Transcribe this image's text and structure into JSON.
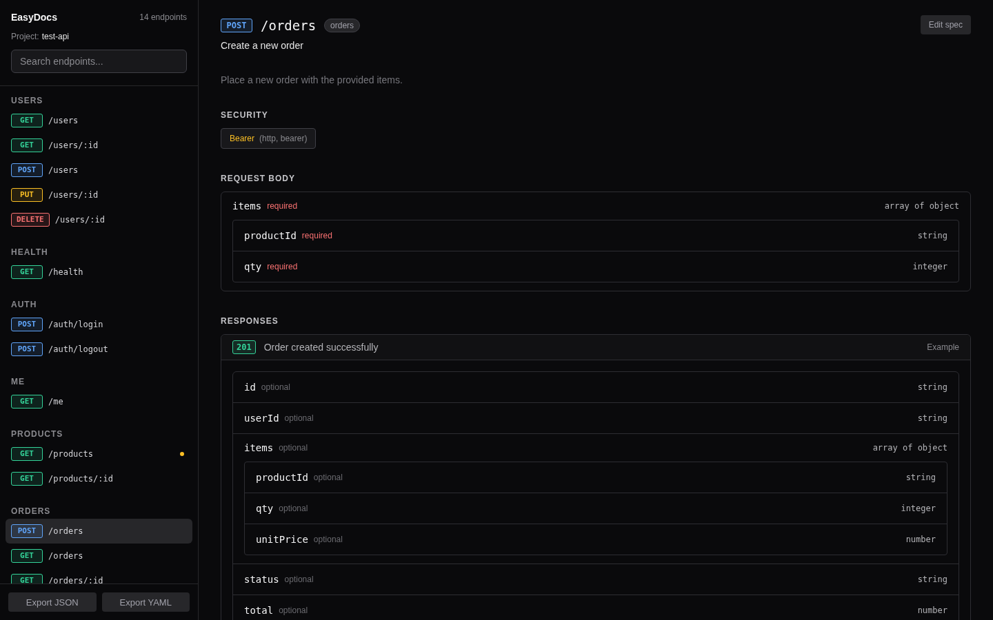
{
  "sidebar": {
    "title": "EasyDocs",
    "count": "14 endpoints",
    "project_label": "Project:",
    "project": "test-api",
    "search": {
      "placeholder": "Search endpoints..."
    },
    "groups": [
      {
        "label": "USERS",
        "items": [
          {
            "method": "GET",
            "color": "#34d399",
            "path": "/users",
            "selected": false,
            "modified": false
          },
          {
            "method": "GET",
            "color": "#34d399",
            "path": "/users/:id",
            "selected": false,
            "modified": false
          },
          {
            "method": "POST",
            "color": "#60a5fa",
            "path": "/users",
            "selected": false,
            "modified": false
          },
          {
            "method": "PUT",
            "color": "#fbbf24",
            "path": "/users/:id",
            "selected": false,
            "modified": false
          },
          {
            "method": "DELETE",
            "color": "#f87171",
            "path": "/users/:id",
            "selected": false,
            "modified": false
          }
        ]
      },
      {
        "label": "HEALTH",
        "items": [
          {
            "method": "GET",
            "color": "#34d399",
            "path": "/health",
            "selected": false,
            "modified": false
          }
        ]
      },
      {
        "label": "AUTH",
        "items": [
          {
            "method": "POST",
            "color": "#60a5fa",
            "path": "/auth/login",
            "selected": false,
            "modified": false
          },
          {
            "method": "POST",
            "color": "#60a5fa",
            "path": "/auth/logout",
            "selected": false,
            "modified": false
          }
        ]
      },
      {
        "label": "ME",
        "items": [
          {
            "method": "GET",
            "color": "#34d399",
            "path": "/me",
            "selected": false,
            "modified": false
          }
        ]
      },
      {
        "label": "PRODUCTS",
        "items": [
          {
            "method": "GET",
            "color": "#34d399",
            "path": "/products",
            "selected": false,
            "modified": true
          },
          {
            "method": "GET",
            "color": "#34d399",
            "path": "/products/:id",
            "selected": false,
            "modified": false
          }
        ]
      },
      {
        "label": "ORDERS",
        "items": [
          {
            "method": "POST",
            "color": "#60a5fa",
            "path": "/orders",
            "selected": true,
            "modified": false
          },
          {
            "method": "GET",
            "color": "#34d399",
            "path": "/orders",
            "selected": false,
            "modified": false
          },
          {
            "method": "GET",
            "color": "#34d399",
            "path": "/orders/:id",
            "selected": false,
            "modified": false
          }
        ]
      }
    ],
    "buttons": [
      "Export JSON",
      "Export YAML"
    ]
  },
  "endpoint": {
    "method": "POST",
    "color": "#60a5fa",
    "path": "/orders",
    "tag": "orders",
    "summary": "Create a new order",
    "description": "Place a new order with the provided items.",
    "edit_button": "Edit spec"
  },
  "security": {
    "heading": "SECURITY",
    "scheme": "Bearer",
    "detail": "(http, bearer)"
  },
  "request_body": {
    "heading": "REQUEST BODY",
    "fields": [
      {
        "name": "items",
        "flag": "required",
        "required": true,
        "type": "array of object",
        "children": [
          {
            "name": "productId",
            "flag": "required",
            "required": true,
            "type": "string"
          },
          {
            "name": "qty",
            "flag": "required",
            "required": true,
            "type": "integer"
          }
        ]
      }
    ]
  },
  "responses": {
    "heading": "RESPONSES",
    "items": [
      {
        "code": "201",
        "color": "#34d399",
        "description": "Order created successfully",
        "example": "Example",
        "fields": [
          {
            "name": "id",
            "flag": "optional",
            "required": false,
            "type": "string"
          },
          {
            "name": "userId",
            "flag": "optional",
            "required": false,
            "type": "string"
          },
          {
            "name": "items",
            "flag": "optional",
            "required": false,
            "type": "array of object",
            "children": [
              {
                "name": "productId",
                "flag": "optional",
                "required": false,
                "type": "string"
              },
              {
                "name": "qty",
                "flag": "optional",
                "required": false,
                "type": "integer"
              },
              {
                "name": "unitPrice",
                "flag": "optional",
                "required": false,
                "type": "number"
              }
            ]
          },
          {
            "name": "status",
            "flag": "optional",
            "required": false,
            "type": "string"
          },
          {
            "name": "total",
            "flag": "optional",
            "required": false,
            "type": "number"
          }
        ]
      }
    ]
  }
}
